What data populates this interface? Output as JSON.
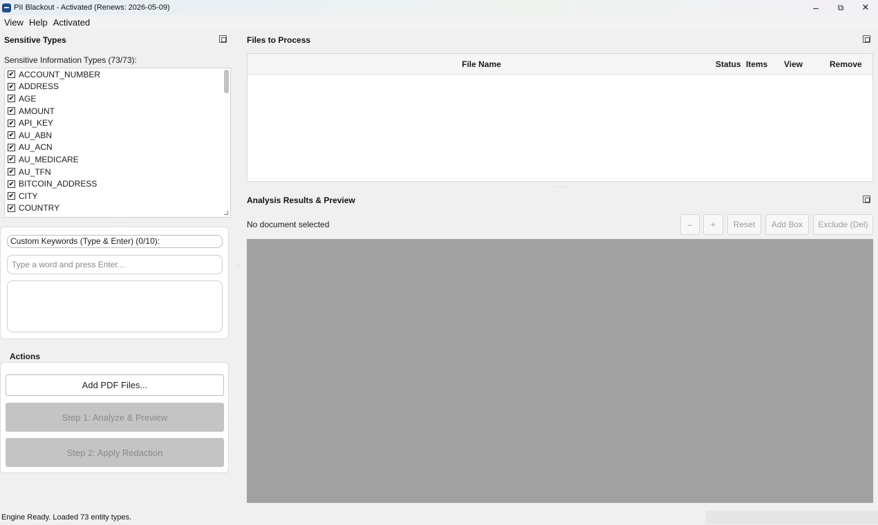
{
  "window": {
    "title": "PII Blackout - Activated (Renews: 2026-05-09)",
    "controls": {
      "minimize": "–",
      "restore": "⧉",
      "close": "✕"
    }
  },
  "menu": [
    "View",
    "Help",
    "Activated"
  ],
  "sensitive_panel": {
    "title": "Sensitive Types",
    "list_label": "Sensitive Information Types (73/73):",
    "types": [
      {
        "label": "ACCOUNT_NUMBER",
        "checked": true
      },
      {
        "label": "ADDRESS",
        "checked": true
      },
      {
        "label": "AGE",
        "checked": true
      },
      {
        "label": "AMOUNT",
        "checked": true
      },
      {
        "label": "API_KEY",
        "checked": true
      },
      {
        "label": "AU_ABN",
        "checked": true
      },
      {
        "label": "AU_ACN",
        "checked": true
      },
      {
        "label": "AU_MEDICARE",
        "checked": true
      },
      {
        "label": "AU_TFN",
        "checked": true
      },
      {
        "label": "BITCOIN_ADDRESS",
        "checked": true
      },
      {
        "label": "CITY",
        "checked": true
      },
      {
        "label": "COUNTRY",
        "checked": true
      }
    ],
    "check_glyph": "✔"
  },
  "keywords": {
    "label": "Custom Keywords (Type & Enter) (0/10):",
    "placeholder": "Type a word and press Enter...",
    "value": ""
  },
  "actions": {
    "title": "Actions",
    "add_files": "Add PDF Files...",
    "step1": "Step 1: Analyze & Preview",
    "step2": "Step 2: Apply Redaction"
  },
  "files_panel": {
    "title": "Files to Process",
    "columns": {
      "file_name": "File Name",
      "status": "Status",
      "items": "Items",
      "view": "View",
      "remove": "Remove"
    },
    "rows": []
  },
  "analysis_panel": {
    "title": "Analysis Results & Preview",
    "document_status": "No document selected",
    "toolbar": {
      "zoom_out": "–",
      "zoom_in": "+",
      "reset": "Reset",
      "add_box": "Add Box",
      "exclude": "Exclude (Del)"
    }
  },
  "status_bar": {
    "message": "Engine Ready. Loaded 73 entity types."
  },
  "colors": {
    "preview_bg": "#a1a1a1",
    "disabled_button": "#c4c4c4",
    "app_icon": "#1e4f8c"
  }
}
